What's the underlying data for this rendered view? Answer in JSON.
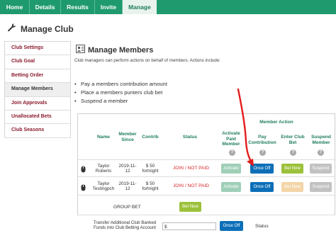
{
  "nav": {
    "tabs": [
      {
        "label": "Home",
        "active": false
      },
      {
        "label": "Details",
        "active": false
      },
      {
        "label": "Results",
        "active": false
      },
      {
        "label": "Invite",
        "active": false
      },
      {
        "label": "Manage",
        "active": true
      }
    ]
  },
  "page": {
    "title": "Manage Club",
    "icon": "wrench-icon"
  },
  "sidebar": {
    "items": [
      {
        "label": "Club Settings",
        "active": false
      },
      {
        "label": "Club Goal",
        "active": false
      },
      {
        "label": "Betting Order",
        "active": false
      },
      {
        "label": "Manage Members",
        "active": true
      },
      {
        "label": "Join Approvals",
        "active": false
      },
      {
        "label": "Unallocated Bets",
        "active": false
      },
      {
        "label": "Club Seasons",
        "active": false
      }
    ]
  },
  "section": {
    "title": "Manage Members",
    "icon": "members-icon",
    "description": "Club managers can perform actions on behalf of members. Actions include:",
    "bullets": [
      "Pay a members contribution amount",
      "Place a members punters club bet",
      "Suspend a member"
    ]
  },
  "table": {
    "group_header": "Member Action",
    "headers": {
      "name": "Name",
      "member_since": "Member Since",
      "contrib": "Contrib",
      "status": "Status",
      "activate": "Activate Paid Member",
      "pay": "Pay Contribution",
      "enter": "Enter Club Bet",
      "suspend": "Suspend Member"
    },
    "help_icon": "?",
    "rows": [
      {
        "name": "Taylor Roberts",
        "since": "2019-11-12",
        "contrib": "$ 50 fortnight",
        "status": "JOIN / NOT PAID",
        "activate": "Activate",
        "pay": "Once Off",
        "bet": "Bet Now",
        "suspend": "Suspend",
        "bet_disabled": false
      },
      {
        "name": "Taylor Testingpch",
        "since": "2019-11-12",
        "contrib": "$ 50 fortnight",
        "status": "JOIN / NOT PAID",
        "activate": "Activate",
        "pay": "Once Off",
        "bet": "Bet Now",
        "suspend": "Suspend",
        "bet_disabled": true
      }
    ],
    "group_bet": {
      "label": "GROUP BET",
      "button": "Bet Now"
    },
    "transfer": {
      "text": "Transfer Additional Club Banked Funds into Club Betting Account",
      "input_value": "$",
      "button": "Once Off",
      "status_label": "Status"
    }
  },
  "colors": {
    "nav_green": "#1f9a6e",
    "header_green": "#1f7d5a",
    "sidebar_text": "#8b1a2d",
    "status_red": "#d9282b",
    "once_off_blue": "#0d6fb8",
    "bet_now_green": "#9cc13a",
    "annotation_arrow": "#e41d1d"
  }
}
